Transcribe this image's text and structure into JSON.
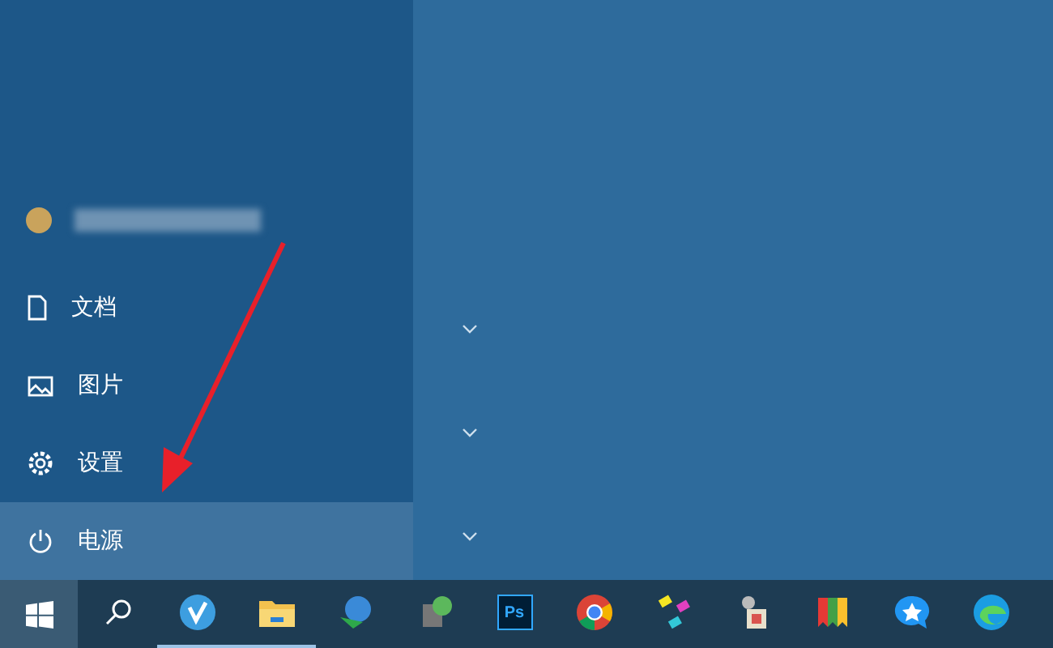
{
  "menu_items": [
    {
      "kind": "document",
      "label": "文档",
      "selected": false
    },
    {
      "kind": "picture",
      "label": "图片",
      "selected": false
    },
    {
      "kind": "settings",
      "label": "设置",
      "selected": false
    },
    {
      "kind": "power",
      "label": "电源",
      "selected": true
    }
  ],
  "tile_groups": [
    {
      "expanded": false
    },
    {
      "expanded": false
    },
    {
      "expanded": false
    }
  ],
  "taskbar": {
    "apps": [
      {
        "kind": "v",
        "running": true
      },
      {
        "kind": "folder",
        "running": true
      },
      {
        "kind": "globe",
        "running": false
      },
      {
        "kind": "tool",
        "running": false
      },
      {
        "kind": "ps",
        "label": "Ps",
        "running": false
      },
      {
        "kind": "chrome",
        "running": false
      },
      {
        "kind": "pins",
        "running": false
      },
      {
        "kind": "keys",
        "running": false
      },
      {
        "kind": "flag",
        "running": false
      },
      {
        "kind": "chat",
        "running": false
      },
      {
        "kind": "edge",
        "running": false
      }
    ]
  }
}
